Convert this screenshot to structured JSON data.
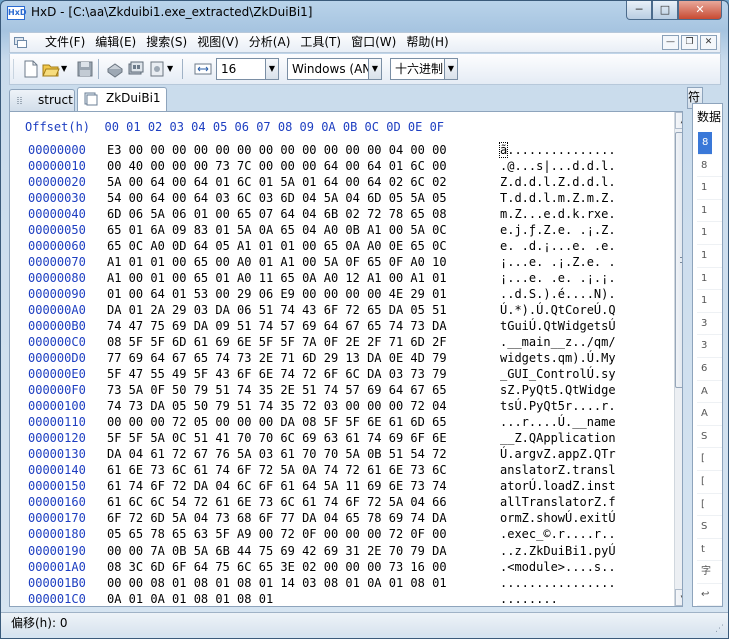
{
  "window": {
    "title": "HxD - [C:\\aa\\Zkduibi1.exe_extracted\\ZkDuiBi1]",
    "minimize_label": "─",
    "maximize_label": "□",
    "close_label": "✕",
    "app_icon_text": "HxD"
  },
  "menu": {
    "items": [
      "文件(F)",
      "编辑(E)",
      "搜索(S)",
      "视图(V)",
      "分析(A)",
      "工具(T)",
      "窗口(W)",
      "帮助(H)"
    ],
    "mdi_minimize": "—",
    "mdi_restore": "❐",
    "mdi_close": "✕"
  },
  "toolbar": {
    "bytes_per_row_value": "16",
    "charset_value": "Windows (AN",
    "offset_base_value": "十六进制",
    "dropdown_arrow": "▼",
    "icons": [
      "new-file-icon",
      "open-folder-icon",
      "save-icon",
      "disk-tools-icon",
      "ram-icon",
      "disk-image-icon",
      "columns-width-icon"
    ]
  },
  "tabs": [
    {
      "label": "struct",
      "active": false
    },
    {
      "label": "ZkDuiBi1",
      "active": true
    }
  ],
  "side_panel": {
    "tab_label": "符",
    "title": "数据",
    "items": [
      "8",
      "8",
      "1",
      "1",
      "1",
      "1",
      "1",
      "1",
      "3",
      "3",
      "6",
      "A",
      "A",
      "S",
      "[",
      "[",
      "[",
      "S",
      "t",
      "字",
      "↩"
    ]
  },
  "hex_view": {
    "header": "Offset(h)  00 01 02 03 04 05 06 07 08 09 0A 0B 0C 0D 0E 0F",
    "rows": [
      {
        "offset": "00000000",
        "hex": "E3 00 00 00 00 00 00 00 00 00 00 00 00 04 00 00",
        "ascii": "ã..............."
      },
      {
        "offset": "00000010",
        "hex": "00 40 00 00 00 73 7C 00 00 00 64 00 64 01 6C 00",
        "ascii": ".@...s|...d.d.l."
      },
      {
        "offset": "00000020",
        "hex": "5A 00 64 00 64 01 6C 01 5A 01 64 00 64 02 6C 02",
        "ascii": "Z.d.d.l.Z.d.d.l."
      },
      {
        "offset": "00000030",
        "hex": "54 00 64 00 64 03 6C 03 6D 04 5A 04 6D 05 5A 05",
        "ascii": "T.d.d.l.m.Z.m.Z."
      },
      {
        "offset": "00000040",
        "hex": "6D 06 5A 06 01 00 65 07 64 04 6B 02 72 78 65 08",
        "ascii": "m.Z...e.d.k.rxe."
      },
      {
        "offset": "00000050",
        "hex": "65 01 6A 09 83 01 5A 0A 65 04 A0 0B A1 00 5A 0C",
        "ascii": "e.j.ƒ.Z.e. .¡.Z."
      },
      {
        "offset": "00000060",
        "hex": "65 0C A0 0D 64 05 A1 01 01 00 65 0A A0 0E 65 0C",
        "ascii": "e. .d.¡...e. .e."
      },
      {
        "offset": "00000070",
        "hex": "A1 01 01 00 65 00 A0 01 A1 00 5A 0F 65 0F A0 10",
        "ascii": "¡...e. .¡.Z.e. ."
      },
      {
        "offset": "00000080",
        "hex": "A1 00 01 00 65 01 A0 11 65 0A A0 12 A1 00 A1 01",
        "ascii": "¡...e. .e. .¡.¡."
      },
      {
        "offset": "00000090",
        "hex": "01 00 64 01 53 00 29 06 E9 00 00 00 00 4E 29 01",
        "ascii": "..d.S.).é....N)."
      },
      {
        "offset": "000000A0",
        "hex": "DA 01 2A 29 03 DA 06 51 74 43 6F 72 65 DA 05 51",
        "ascii": "Ú.*).Ú.QtCoreÚ.Q"
      },
      {
        "offset": "000000B0",
        "hex": "74 47 75 69 DA 09 51 74 57 69 64 67 65 74 73 DA",
        "ascii": "tGuiÚ.QtWidgetsÚ"
      },
      {
        "offset": "000000C0",
        "hex": "08 5F 5F 6D 61 69 6E 5F 5F 7A 0F 2E 2F 71 6D 2F",
        "ascii": ".__main__z../qm/"
      },
      {
        "offset": "000000D0",
        "hex": "77 69 64 67 65 74 73 2E 71 6D 29 13 DA 0E 4D 79",
        "ascii": "widgets.qm).Ú.My"
      },
      {
        "offset": "000000E0",
        "hex": "5F 47 55 49 5F 43 6F 6E 74 72 6F 6C DA 03 73 79",
        "ascii": "_GUI_ControlÚ.sy"
      },
      {
        "offset": "000000F0",
        "hex": "73 5A 0F 50 79 51 74 35 2E 51 74 57 69 64 67 65",
        "ascii": "sZ.PyQt5.QtWidge"
      },
      {
        "offset": "00000100",
        "hex": "74 73 DA 05 50 79 51 74 35 72 03 00 00 00 72 04",
        "ascii": "tsÚ.PyQt5r....r."
      },
      {
        "offset": "00000110",
        "hex": "00 00 00 72 05 00 00 00 DA 08 5F 5F 6E 61 6D 65",
        "ascii": "...r....Ú.__name"
      },
      {
        "offset": "00000120",
        "hex": "5F 5F 5A 0C 51 41 70 70 6C 69 63 61 74 69 6F 6E",
        "ascii": "__Z.QApplication"
      },
      {
        "offset": "00000130",
        "hex": "DA 04 61 72 67 76 5A 03 61 70 70 5A 0B 51 54 72",
        "ascii": "Ú.argvZ.appZ.QTr"
      },
      {
        "offset": "00000140",
        "hex": "61 6E 73 6C 61 74 6F 72 5A 0A 74 72 61 6E 73 6C",
        "ascii": "anslatorZ.transl"
      },
      {
        "offset": "00000150",
        "hex": "61 74 6F 72 DA 04 6C 6F 61 64 5A 11 69 6E 73 74",
        "ascii": "atorÚ.loadZ.inst"
      },
      {
        "offset": "00000160",
        "hex": "61 6C 6C 54 72 61 6E 73 6C 61 74 6F 72 5A 04 66",
        "ascii": "allTranslatorZ.f"
      },
      {
        "offset": "00000170",
        "hex": "6F 72 6D 5A 04 73 68 6F 77 DA 04 65 78 69 74 DA",
        "ascii": "ormZ.showÚ.exitÚ"
      },
      {
        "offset": "00000180",
        "hex": "05 65 78 65 63 5F A9 00 72 0F 00 00 00 72 0F 00",
        "ascii": ".exec_©.r....r.."
      },
      {
        "offset": "00000190",
        "hex": "00 00 7A 0B 5A 6B 44 75 69 42 69 31 2E 70 79 DA",
        "ascii": "..z.ZkDuiBi1.pyÚ"
      },
      {
        "offset": "000001A0",
        "hex": "08 3C 6D 6F 64 75 6C 65 3E 02 00 00 00 73 16 00",
        "ascii": ".<module>....s.."
      },
      {
        "offset": "000001B0",
        "hex": "00 00 08 01 08 01 08 01 14 03 08 01 0A 01 08 01",
        "ascii": "................"
      },
      {
        "offset": "000001C0",
        "hex": "0A 01 0A 01 08 01 08 01",
        "ascii": "........"
      }
    ]
  },
  "status": {
    "text": "偏移(h): 0",
    "grip": "⋰"
  }
}
